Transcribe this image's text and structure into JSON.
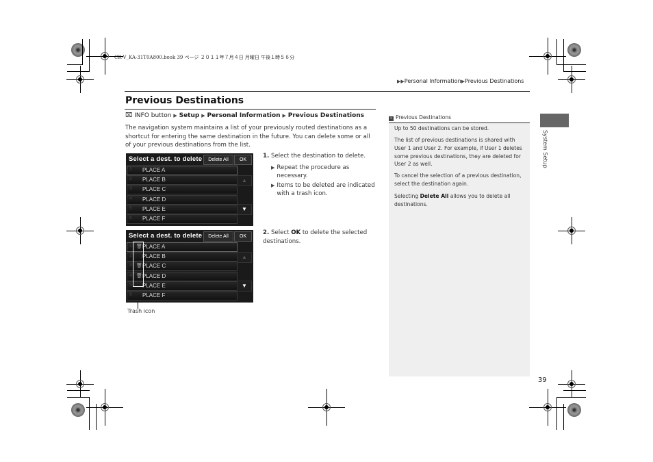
{
  "print_header": "CR-V_KA-31T0A800.book  39 ページ  ２０１１年７月４日  月曜日  午後１時５６分",
  "breadcrumb": {
    "arrows": "▶▶",
    "items": [
      "Personal Information",
      "Previous Destinations"
    ],
    "separator": "▶"
  },
  "page_title": "Previous Destinations",
  "nav_path": {
    "icon": "info-button-icon",
    "start": "INFO button",
    "steps": [
      "Setup",
      "Personal Information",
      "Previous Destinations"
    ],
    "separator": "▶"
  },
  "intro_text": "The navigation system maintains a list of your previously routed destinations as a shortcut for entering the same destination in the future. You can delete some or all of your previous destinations from the list.",
  "screen1": {
    "title": "Select a dest. to delete",
    "delete_all": "Delete All",
    "ok": "OK",
    "rows": [
      {
        "num": "1",
        "label": "PLACE A",
        "trash": false
      },
      {
        "num": "2",
        "label": "PLACE B",
        "trash": false
      },
      {
        "num": "3",
        "label": "PLACE C",
        "trash": false
      },
      {
        "num": "4",
        "label": "PLACE D",
        "trash": false
      },
      {
        "num": "5",
        "label": "PLACE E",
        "trash": false
      },
      {
        "num": "6",
        "label": "PLACE F",
        "trash": false
      }
    ],
    "up_icon": "▲",
    "down_icon": "▼"
  },
  "screen2": {
    "title": "Select a dest. to delete",
    "delete_all": "Delete All",
    "ok": "OK",
    "rows": [
      {
        "num": "1",
        "label": "PLACE A",
        "trash": true
      },
      {
        "num": "2",
        "label": "PLACE B",
        "trash": false
      },
      {
        "num": "3",
        "label": "PLACE C",
        "trash": true
      },
      {
        "num": "4",
        "label": "PLACE D",
        "trash": true
      },
      {
        "num": "5",
        "label": "PLACE E",
        "trash": false
      },
      {
        "num": "6",
        "label": "PLACE F",
        "trash": false
      }
    ],
    "up_icon": "▲",
    "down_icon": "▼",
    "callout": "Trash icon"
  },
  "steps": [
    {
      "num": "1.",
      "text": "Select the destination to delete.",
      "bullets": [
        "Repeat the procedure as necessary.",
        "Items to be deleted are indicated with a trash icon."
      ]
    },
    {
      "num": "2.",
      "pre": "Select ",
      "bold": "OK",
      "post": " to delete the selected destinations."
    }
  ],
  "side_note": {
    "title": "Previous Destinations",
    "paragraphs": [
      "Up to 50 destinations can be stored.",
      "The list of previous destinations is shared with User 1 and User 2. For example, if User 1 deletes some previous destinations, they are deleted for User 2 as well.",
      "To cancel the selection of a previous destination, select the destination again."
    ],
    "last": {
      "pre": "Selecting ",
      "bold": "Delete All",
      "post": " allows you to delete all destinations."
    }
  },
  "section_tab": "System Setup",
  "page_number": "39"
}
